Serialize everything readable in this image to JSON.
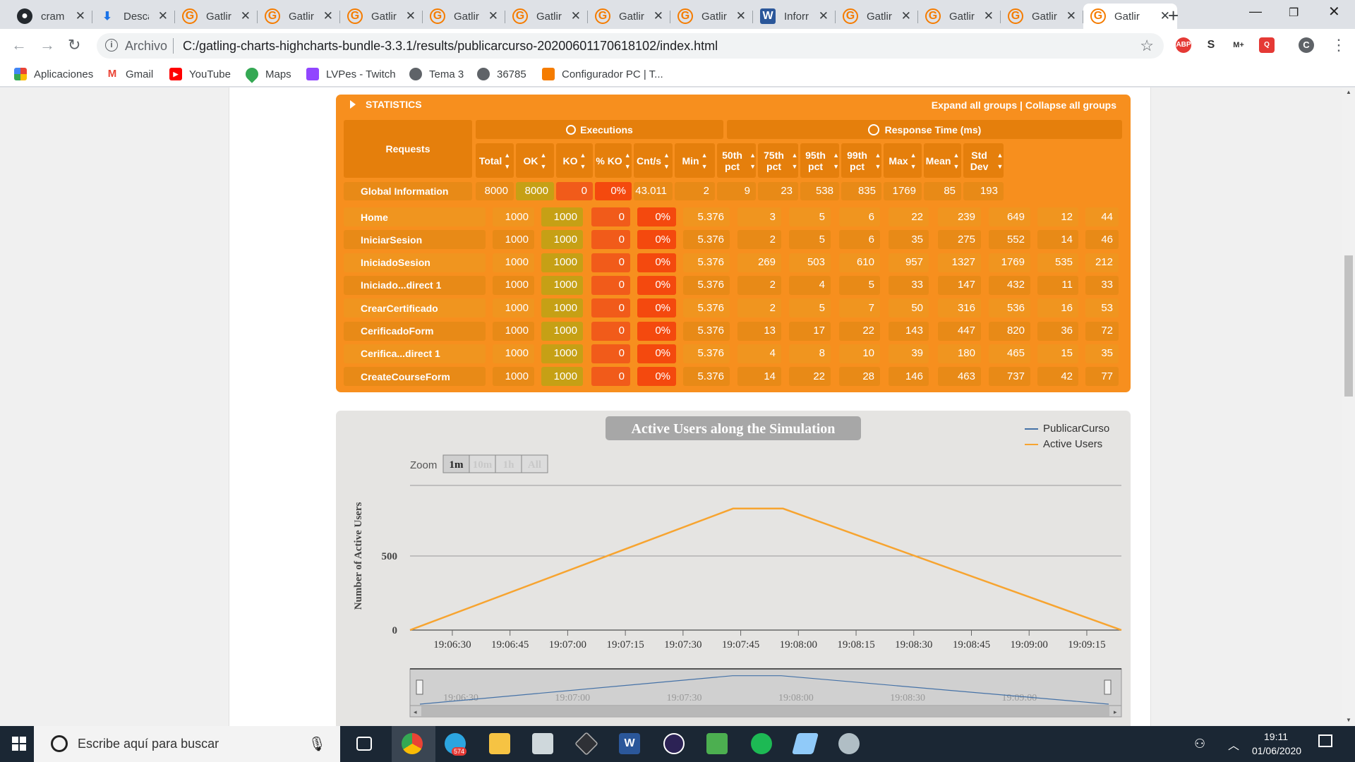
{
  "browser": {
    "tabs": [
      {
        "title": "cram",
        "icon": "github-icon"
      },
      {
        "title": "Desca",
        "icon": "download-icon"
      },
      {
        "title": "Gatlir",
        "icon": "gatling-icon"
      },
      {
        "title": "Gatlir",
        "icon": "gatling-icon"
      },
      {
        "title": "Gatlir",
        "icon": "gatling-icon"
      },
      {
        "title": "Gatlir",
        "icon": "gatling-icon"
      },
      {
        "title": "Gatlir",
        "icon": "gatling-icon"
      },
      {
        "title": "Gatlir",
        "icon": "gatling-icon"
      },
      {
        "title": "Gatlir",
        "icon": "gatling-icon"
      },
      {
        "title": "Inforr",
        "icon": "word-icon"
      },
      {
        "title": "Gatlir",
        "icon": "gatling-icon"
      },
      {
        "title": "Gatlir",
        "icon": "gatling-icon"
      },
      {
        "title": "Gatlir",
        "icon": "gatling-icon"
      },
      {
        "title": "Gatlir",
        "icon": "gatling-icon"
      }
    ],
    "address": {
      "prefix": "Archivo",
      "url": "C:/gatling-charts-highcharts-bundle-3.3.1/results/publicarcurso-20200601170618102/index.html"
    },
    "profile_initial": "C",
    "bookmarks": [
      "Aplicaciones",
      "Gmail",
      "YouTube",
      "Maps",
      "LVPes - Twitch",
      "Tema 3",
      "36785",
      "Configurador PC | T..."
    ]
  },
  "stats": {
    "title": "STATISTICS",
    "expand_all": "Expand all groups",
    "separator": "|",
    "collapse_all": "Collapse all groups",
    "group_executions": "Executions",
    "group_response": "Response Time (ms)",
    "col_requests": "Requests",
    "columns": [
      "Total",
      "OK",
      "KO",
      "% KO",
      "Cnt/s",
      "Min",
      "50th pct",
      "75th pct",
      "95th pct",
      "99th pct",
      "Max",
      "Mean",
      "Std Dev"
    ],
    "global": {
      "name": "Global Information",
      "values": [
        "8000",
        "8000",
        "0",
        "0%",
        "43.011",
        "2",
        "9",
        "23",
        "538",
        "835",
        "1769",
        "85",
        "193"
      ]
    },
    "rows": [
      {
        "name": "Home",
        "values": [
          "1000",
          "1000",
          "0",
          "0%",
          "5.376",
          "3",
          "5",
          "6",
          "22",
          "239",
          "649",
          "12",
          "44"
        ]
      },
      {
        "name": "IniciarSesion",
        "values": [
          "1000",
          "1000",
          "0",
          "0%",
          "5.376",
          "2",
          "5",
          "6",
          "35",
          "275",
          "552",
          "14",
          "46"
        ]
      },
      {
        "name": "IniciadoSesion",
        "values": [
          "1000",
          "1000",
          "0",
          "0%",
          "5.376",
          "269",
          "503",
          "610",
          "957",
          "1327",
          "1769",
          "535",
          "212"
        ]
      },
      {
        "name": "Iniciado...direct 1",
        "values": [
          "1000",
          "1000",
          "0",
          "0%",
          "5.376",
          "2",
          "4",
          "5",
          "33",
          "147",
          "432",
          "11",
          "33"
        ]
      },
      {
        "name": "CrearCertificado",
        "values": [
          "1000",
          "1000",
          "0",
          "0%",
          "5.376",
          "2",
          "5",
          "7",
          "50",
          "316",
          "536",
          "16",
          "53"
        ]
      },
      {
        "name": "CerificadoForm",
        "values": [
          "1000",
          "1000",
          "0",
          "0%",
          "5.376",
          "13",
          "17",
          "22",
          "143",
          "447",
          "820",
          "36",
          "72"
        ]
      },
      {
        "name": "Cerifica...direct 1",
        "values": [
          "1000",
          "1000",
          "0",
          "0%",
          "5.376",
          "4",
          "8",
          "10",
          "39",
          "180",
          "465",
          "15",
          "35"
        ]
      },
      {
        "name": "CreateCourseForm",
        "values": [
          "1000",
          "1000",
          "0",
          "0%",
          "5.376",
          "14",
          "22",
          "28",
          "146",
          "463",
          "737",
          "42",
          "77"
        ]
      }
    ]
  },
  "chart_data": {
    "type": "line",
    "title": "Active Users along the Simulation",
    "ylabel": "Number of Active Users",
    "xlabel": "",
    "zoom_label": "Zoom",
    "zoom_options": [
      "1m",
      "10m",
      "1h",
      "All"
    ],
    "x_ticks": [
      "19:06:30",
      "19:06:45",
      "19:07:00",
      "19:07:15",
      "19:07:30",
      "19:07:45",
      "19:08:00",
      "19:08:15",
      "19:08:30",
      "19:08:45",
      "19:09:00",
      "19:09:15"
    ],
    "y_ticks": [
      0,
      500
    ],
    "ylim": [
      0,
      1000
    ],
    "navigator_ticks": [
      "19:06:30",
      "19:07:00",
      "19:07:30",
      "19:08:00",
      "19:08:30",
      "19:09:00"
    ],
    "legend": [
      "PublicarCurso",
      "Active Users"
    ],
    "series": [
      {
        "name": "Active Users",
        "color": "#f7a430",
        "x": [
          "19:06:19",
          "19:07:43",
          "19:07:56",
          "19:09:24"
        ],
        "values": [
          0,
          840,
          840,
          0
        ]
      }
    ]
  },
  "taskbar": {
    "search_placeholder": "Escribe aquí para buscar",
    "telegram_badge": "574",
    "time": "19:11",
    "date": "01/06/2020"
  }
}
